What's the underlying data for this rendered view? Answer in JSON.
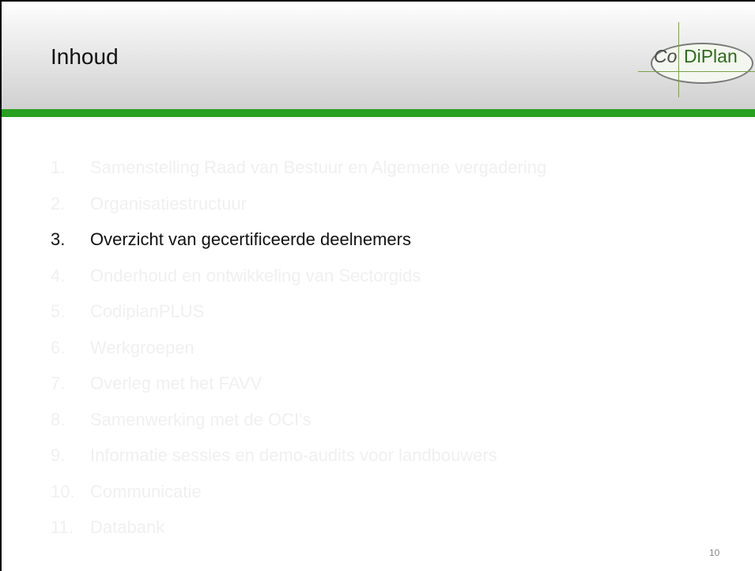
{
  "title": "Inhoud",
  "logo": {
    "part1": "Co",
    "part2": "DiPlan"
  },
  "agenda": [
    {
      "num": "1.",
      "text": "Samenstelling Raad van Bestuur en Algemene vergadering"
    },
    {
      "num": "2.",
      "text": "Organisatiestructuur"
    },
    {
      "num": "3.",
      "text": "Overzicht van gecertificeerde deelnemers"
    },
    {
      "num": "4.",
      "text": "Onderhoud en ontwikkeling van Sectorgids"
    },
    {
      "num": "5.",
      "text": "CodiplanPLUS"
    },
    {
      "num": "6.",
      "text": "Werkgroepen"
    },
    {
      "num": "7.",
      "text": "Overleg met het FAVV"
    },
    {
      "num": "8.",
      "text": "Samenwerking met de OCI’s"
    },
    {
      "num": "9.",
      "text": "Informatie sessies en demo-audits voor landbouwers"
    },
    {
      "num": "10.",
      "text": "Communicatie"
    },
    {
      "num": "11.",
      "text": "Databank"
    }
  ],
  "page_number": "10",
  "colors": {
    "accent_green": "#28a020",
    "inactive_text": "#f0f0f0",
    "active_text": "#111111"
  }
}
